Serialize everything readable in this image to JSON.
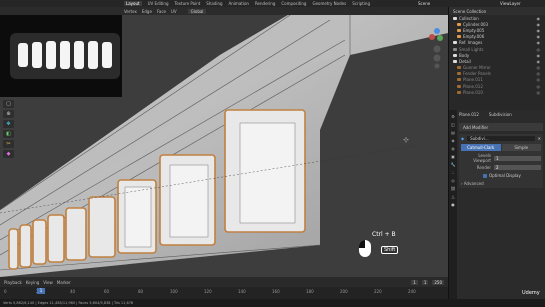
{
  "topbar": {
    "tabs": [
      "Layout",
      "UV Editing",
      "Texture Paint",
      "Shading",
      "Animation",
      "Rendering",
      "Compositing",
      "Geometry Nodes",
      "Scripting"
    ],
    "scene": "Scene",
    "view_layer": "ViewLayer"
  },
  "header": {
    "menus": [
      "Vertex",
      "Edge",
      "Face",
      "UV"
    ],
    "transform": "Global"
  },
  "viewport": {
    "overlay_key": "Ctrl + B",
    "shift_key": "Shift"
  },
  "outliner": {
    "title": "Scene Collection",
    "rows": [
      {
        "label": "Collection",
        "dim": false
      },
      {
        "label": "Cylinder.003",
        "dim": false
      },
      {
        "label": "Empty.005",
        "dim": false
      },
      {
        "label": "Empty.006",
        "dim": false
      },
      {
        "label": "Ref. Images",
        "dim": false
      },
      {
        "label": "Small Lights",
        "dim": true
      },
      {
        "label": "Body",
        "dim": false
      },
      {
        "label": "Detail",
        "dim": false
      },
      {
        "label": "Gunner Mirror",
        "dim": true
      },
      {
        "label": "Fender Panels",
        "dim": true
      },
      {
        "label": "Plane.011",
        "dim": true
      },
      {
        "label": "Plane.012",
        "dim": true
      },
      {
        "label": "Plane.010",
        "dim": true
      }
    ]
  },
  "properties": {
    "object": "Plane.012",
    "sub": "Subdivision",
    "add_modifier": "Add Modifier",
    "modifier_name": "Subdivi...",
    "catmull": "Catmull-Clark",
    "simple": "Simple",
    "levels_viewport_label": "Levels Viewport",
    "levels_viewport": "1",
    "render_label": "Render",
    "render": "2",
    "optimal": "Optimal Display",
    "advanced": "Advanced"
  },
  "timeline": {
    "items": [
      "Playback",
      "Keying",
      "View",
      "Marker"
    ],
    "frame": "1",
    "start": "1",
    "end": "250",
    "ticks": [
      "0",
      "20",
      "40",
      "60",
      "80",
      "100",
      "120",
      "140",
      "160",
      "180",
      "200",
      "220",
      "240"
    ]
  },
  "status": "Verts 5,862/6,140 | Edges 11,458/11,960 | Faces 5,604/5,838 | Tris 11,676",
  "brand": "Udemy"
}
